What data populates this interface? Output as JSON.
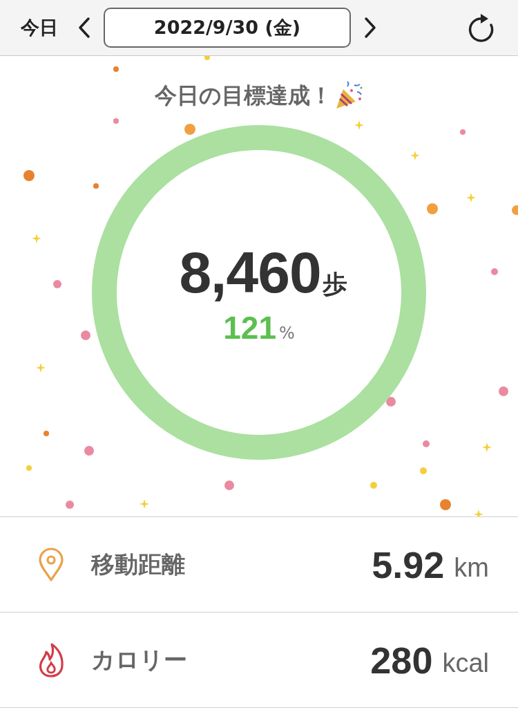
{
  "header": {
    "today_button": "今日",
    "date": "2022/9/30 (金)"
  },
  "goal": {
    "message": "今日の目標達成！",
    "steps": "8,460",
    "steps_unit": "歩",
    "percent": "121",
    "percent_unit": "%",
    "level": 1
  },
  "stats": [
    {
      "kind": "distance",
      "label": "移動距離",
      "value": "5.92",
      "unit": "km"
    },
    {
      "kind": "calories",
      "label": "カロリー",
      "value": "280",
      "unit": "kcal"
    }
  ]
}
